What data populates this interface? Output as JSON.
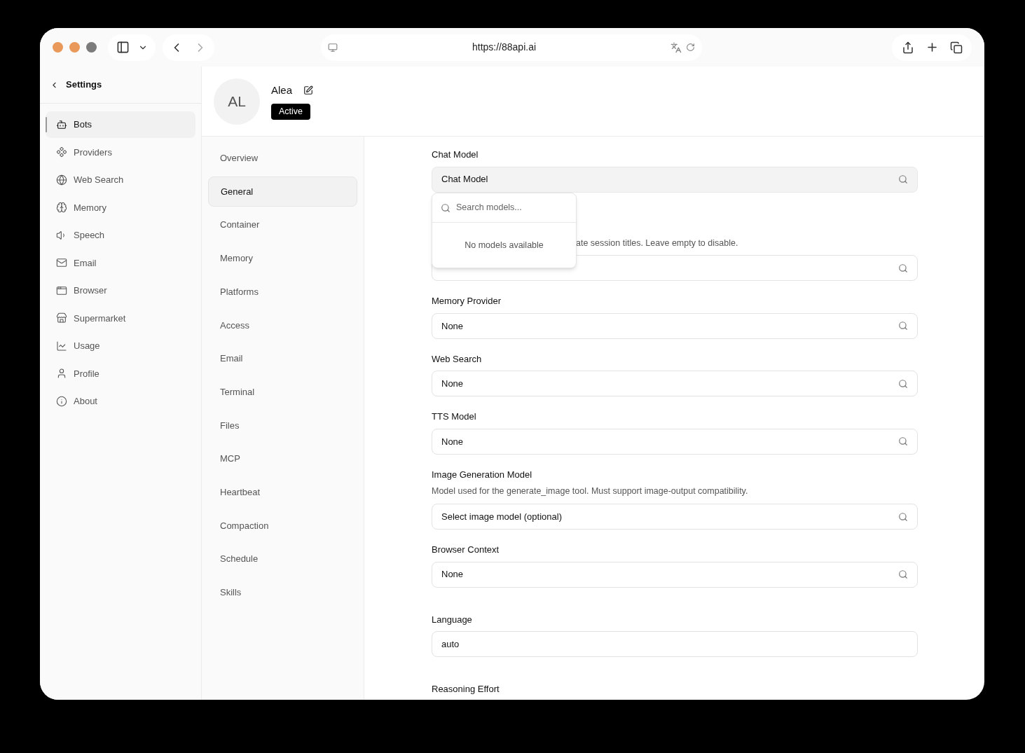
{
  "browser": {
    "url": "https://88api.ai"
  },
  "sidebar": {
    "title": "Settings",
    "items": [
      {
        "label": "Bots",
        "selected": true
      },
      {
        "label": "Providers",
        "selected": false
      },
      {
        "label": "Web Search",
        "selected": false
      },
      {
        "label": "Memory",
        "selected": false
      },
      {
        "label": "Speech",
        "selected": false
      },
      {
        "label": "Email",
        "selected": false
      },
      {
        "label": "Browser",
        "selected": false
      },
      {
        "label": "Supermarket",
        "selected": false
      },
      {
        "label": "Usage",
        "selected": false
      },
      {
        "label": "Profile",
        "selected": false
      },
      {
        "label": "About",
        "selected": false
      }
    ]
  },
  "bot": {
    "initials": "AL",
    "name": "Alea",
    "status": "Active"
  },
  "subnav": [
    {
      "label": "Overview",
      "selected": false
    },
    {
      "label": "General",
      "selected": true
    },
    {
      "label": "Container",
      "selected": false
    },
    {
      "label": "Memory",
      "selected": false
    },
    {
      "label": "Platforms",
      "selected": false
    },
    {
      "label": "Access",
      "selected": false
    },
    {
      "label": "Email",
      "selected": false
    },
    {
      "label": "Terminal",
      "selected": false
    },
    {
      "label": "Files",
      "selected": false
    },
    {
      "label": "MCP",
      "selected": false
    },
    {
      "label": "Heartbeat",
      "selected": false
    },
    {
      "label": "Compaction",
      "selected": false
    },
    {
      "label": "Schedule",
      "selected": false
    },
    {
      "label": "Skills",
      "selected": false
    }
  ],
  "fields": [
    {
      "kind": "select",
      "label": "Chat Model",
      "value": "Chat Model",
      "focused": true
    },
    {
      "kind": "partly_hidden",
      "description": "ate session titles. Leave empty to disable.",
      "focused": false
    },
    {
      "kind": "select",
      "label": "Memory Provider",
      "value": "None",
      "focused": false
    },
    {
      "kind": "select",
      "label": "Web Search",
      "value": "None",
      "focused": false
    },
    {
      "kind": "select",
      "label": "TTS Model",
      "value": "None",
      "focused": false
    },
    {
      "kind": "select",
      "label": "Image Generation Model",
      "description": "Model used for the generate_image tool. Must support image-output compatibility.",
      "value": "Select image model (optional)",
      "focused": false
    },
    {
      "kind": "select",
      "label": "Browser Context",
      "value": "None",
      "focused": false
    },
    {
      "kind": "divider"
    },
    {
      "kind": "text",
      "label": "Language",
      "value": "auto",
      "focused": false
    },
    {
      "kind": "divider"
    },
    {
      "kind": "label_only",
      "label": "Reasoning Effort"
    }
  ],
  "dropdown": {
    "placeholder": "Search models...",
    "empty_text": "No models available"
  }
}
